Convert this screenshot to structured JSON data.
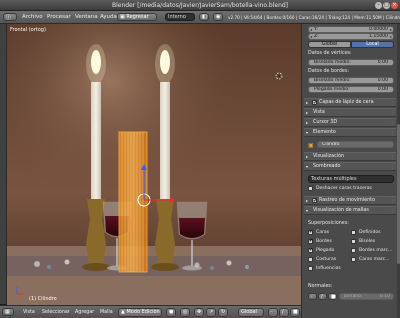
{
  "window": {
    "title": "Blender [/media/datos/Javier/JavierSam/botella-vino.blend]"
  },
  "infobar": {
    "menu": [
      "Archivo",
      "Procesar",
      "Ventana",
      "Ayuda"
    ],
    "layout_label": "Regresar",
    "scene_label": "Interno",
    "stats": "v2.70 | Vé:54/64 | Bordes:0/160 | Caras:16/24 | Triáng:124 | Mem:11.50M | Cilindro"
  },
  "viewport": {
    "view_label": "Frontal (ortog)",
    "object_label": "(1) Cilindro"
  },
  "viewport_header": {
    "menu": [
      "Vista",
      "Seleccionar",
      "Agregar",
      "Malla"
    ],
    "mode": "Modo Edición",
    "pivot": "Global"
  },
  "properties": {
    "y_label": "Y:",
    "y_value": "0.00000",
    "z_label": "Z:",
    "z_value": "1.15000",
    "tabs": [
      "Global",
      "Local"
    ],
    "active_tab": "Local",
    "vertex_data_header": "Datos de vértices:",
    "vertex_weight_label": "Biselado medio:",
    "vertex_weight_value": "0.00",
    "edge_data_header": "Datos de bordes:",
    "edge_bevel_label": "Biselado medio:",
    "edge_bevel_value": "0.00",
    "edge_crease_label": "Plegado medio:",
    "edge_crease_value": "0.00",
    "panels": {
      "grease_layers": "Capas de lápiz de cera",
      "view": "Vista",
      "cursor": "Cursor 3D",
      "item": "Elemento",
      "display": "Visualización",
      "shading": "Sombreado",
      "motion_tracking": "Rastreo de movimiento",
      "mesh_display": "Visualización de mallas"
    },
    "item_name": "Cilindro",
    "shading_mode": "Texturas múltiples",
    "shading_check_label": "Deshacer caras traseras",
    "overlays_label": "Superposiciones:",
    "overlays": [
      {
        "label": "Caras",
        "checked": true
      },
      {
        "label": "Definidos",
        "checked": false
      },
      {
        "label": "Bordes",
        "checked": true
      },
      {
        "label": "Biseles",
        "checked": false
      },
      {
        "label": "Plegado",
        "checked": true
      },
      {
        "label": "Bordes marc...",
        "checked": false
      },
      {
        "label": "Costuras",
        "checked": false
      },
      {
        "label": "Caras marc...",
        "checked": false
      }
    ],
    "influence_label": "Influencias",
    "normals_label": "Normales:",
    "size_label": "Tamaño:",
    "size_value": "0.10"
  }
}
